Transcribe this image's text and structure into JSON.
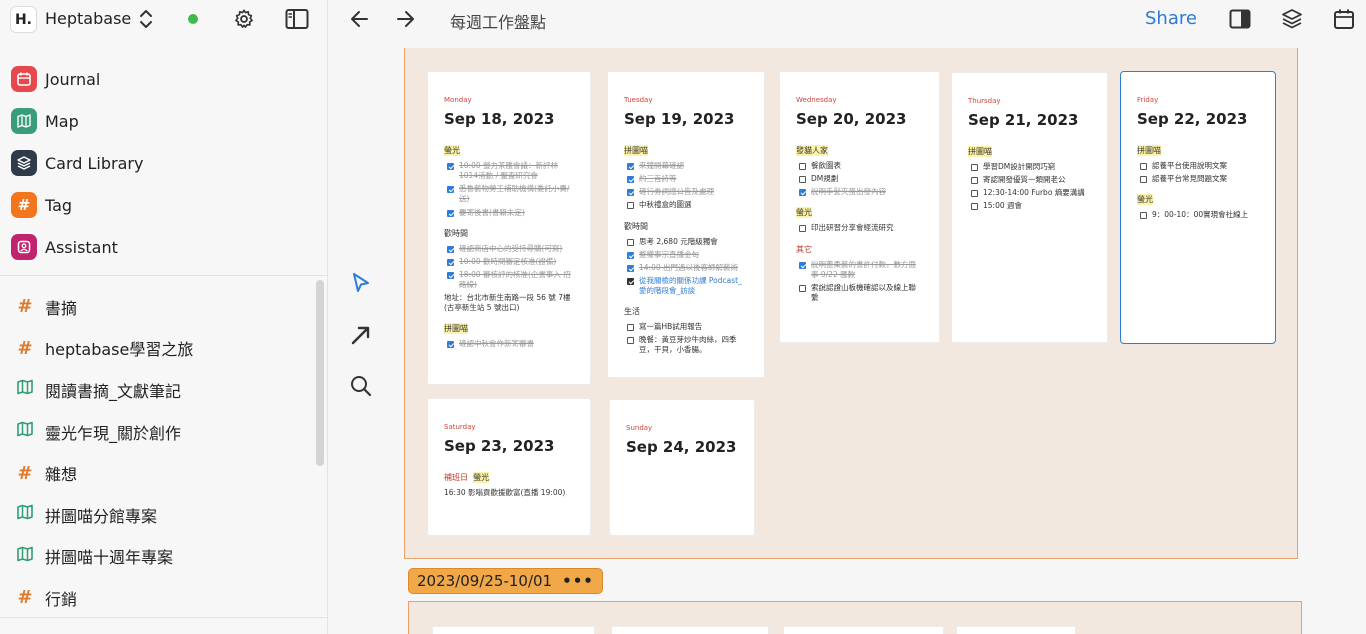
{
  "workspace": {
    "logo": "H.",
    "name": "Heptabase"
  },
  "nav": [
    {
      "label": "Journal",
      "icon": "calendar-icon",
      "color": "#e5484d"
    },
    {
      "label": "Map",
      "icon": "map-icon",
      "color": "#3a9d7a"
    },
    {
      "label": "Card Library",
      "icon": "layers-icon",
      "color": "#2f3a4a"
    },
    {
      "label": "Tag",
      "icon": "hash-icon",
      "color": "#f2761e"
    },
    {
      "label": "Assistant",
      "icon": "assistant-icon",
      "color": "#c0246e"
    }
  ],
  "tree": [
    {
      "label": "書摘",
      "kind": "tag"
    },
    {
      "label": "heptabase學習之旅",
      "kind": "tag"
    },
    {
      "label": "閱讀書摘_文獻筆記",
      "kind": "map"
    },
    {
      "label": "靈光乍現_關於創作",
      "kind": "map"
    },
    {
      "label": "雜想",
      "kind": "tag"
    },
    {
      "label": "拼圖喵分館專案",
      "kind": "map"
    },
    {
      "label": "拼圖喵十週年專案",
      "kind": "map"
    },
    {
      "label": "行銷",
      "kind": "tag"
    }
  ],
  "topbar": {
    "title": "每週工作盤點",
    "share": "Share"
  },
  "next_section": {
    "label": "2023/09/25-10/01",
    "more": "•••"
  },
  "cards": {
    "mon": {
      "dow": "Monday",
      "date": "Sep 18, 2023",
      "h1": "螢光",
      "t1": "10:00 螢力茶匯會議：新評林 1014活動 / 聖盃研究會",
      "t2": "悉魯藝物勞工補助機構(委託小賣/送)",
      "t3": "要寄後書(書籍未定)",
      "h2": "歡時間",
      "t4": "確認商店中心的受持尋購(可寫)",
      "t5": "10:00 歡時間審定核准(證備)",
      "t6": "18:00 審核評的核准(企書事入 招路線)",
      "p1": "地址：台北市新生南路一段 56 號 7樓(古亭新生站 5 號出口)",
      "h3": "拼圖喵",
      "t7": "確認中秋會作新寄審書"
    },
    "tue": {
      "dow": "Tuesday",
      "date": "Sep 19, 2023",
      "h1": "拼圖喵",
      "t1": "來鐘開幕確認",
      "t2": "約三百詩等",
      "t3": "確行券詞總公告及處理",
      "t4": "中秋禮盒的圖選",
      "h2": "歡時間",
      "t5": "思考 2,680 元階級獨會",
      "t6": "整權事宗直播金句",
      "t7": "14:00 出門過以後客師解藝術",
      "p1": "從我關檢的關係功課 Podcast_愛的階段會_訪談",
      "h3": "生活",
      "t8": "寫一篇HB試用報告",
      "t9": "晚餐：黃豆芽炒牛肉絲，四季豆，干貝，小香腸。"
    },
    "wed": {
      "dow": "Wednesday",
      "date": "Sep 20, 2023",
      "h1": "發貓人家",
      "t1": "餐飲圖表",
      "t2": "DM規劃",
      "t3": "說明手髮夾蛋出發內容",
      "h2": "螢光",
      "t4": "印出研習分享會經流研究",
      "h3": "其它",
      "t5": "說明蓋柔藝的書許付款，數方面事 9/22 匯款",
      "t6": "索說認證山板機確認以及線上聯繫"
    },
    "thu": {
      "dow": "Thursday",
      "date": "Sep 21, 2023",
      "h1": "拼圖喵",
      "t1": "學習DM設計開閃巧窮",
      "t2": "寄認開發優質一類開老公",
      "t3": "12:30-14:00 Furbo 熵要溝講",
      "t4": "15:00 週會"
    },
    "fri": {
      "dow": "Friday",
      "date": "Sep 22, 2023",
      "h1": "拼圖喵",
      "t1": "認養平台使用說明文案",
      "t2": "認養平台常見問題文案",
      "h2": "螢光",
      "t3": "9：00-10：00實現會社線上"
    },
    "sat": {
      "dow": "Saturday",
      "date": "Sep 23, 2023",
      "h1": "補班日",
      "h2": "螢光",
      "p1": "16:30 影嗡貢歡援歡富(直播 19:00)"
    },
    "sun": {
      "dow": "Sunday",
      "date": "Sep 24, 2023"
    }
  }
}
